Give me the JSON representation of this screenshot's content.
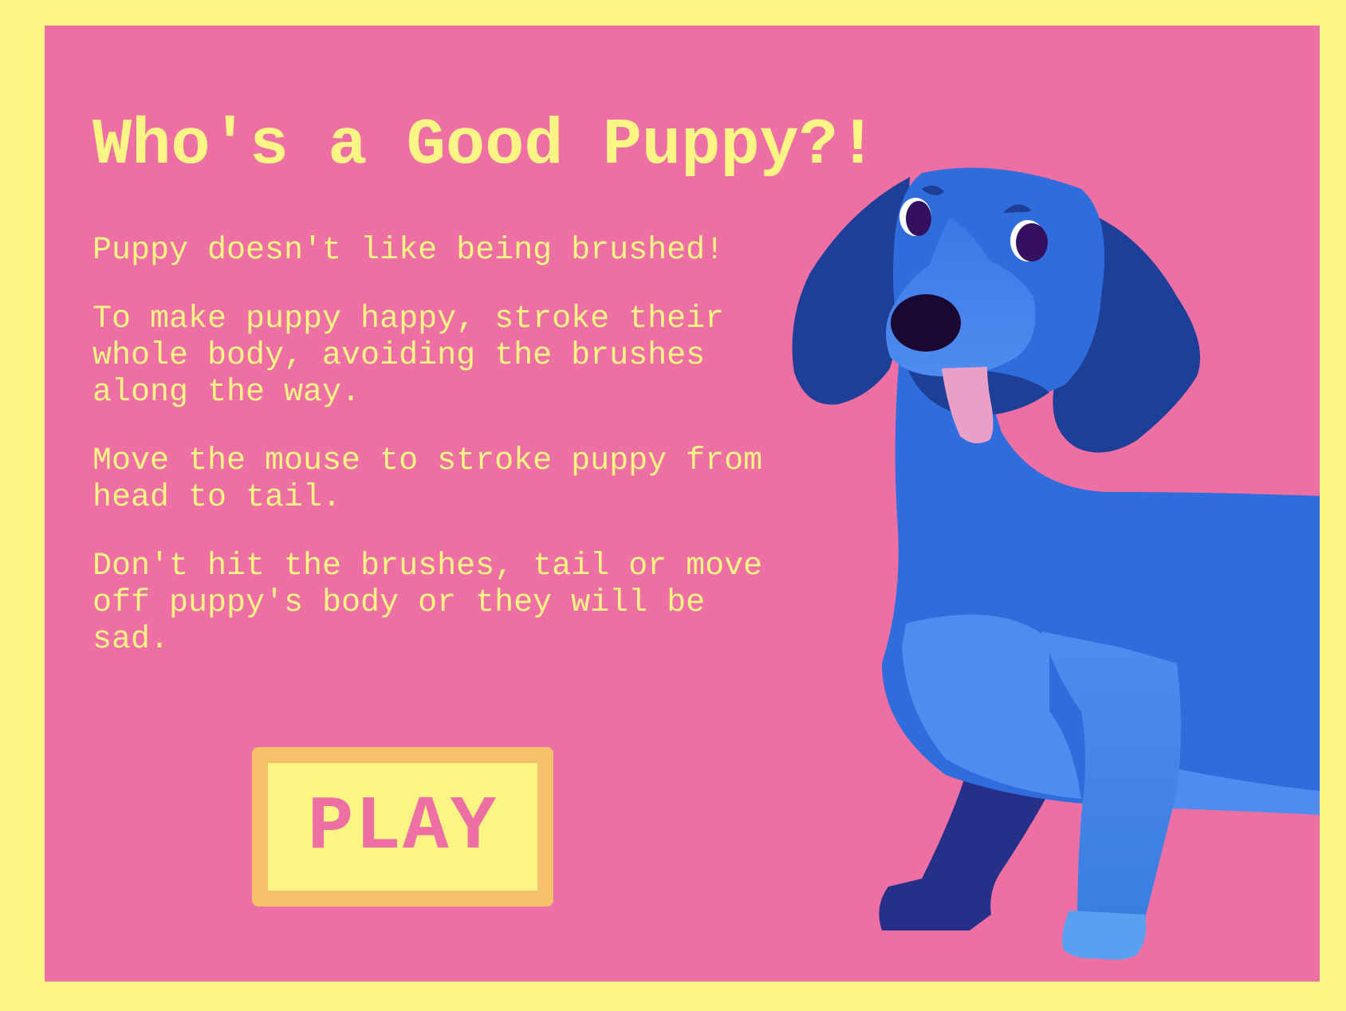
{
  "game": {
    "title": "Who's a Good Puppy?!",
    "instructions": [
      "Puppy doesn't like being brushed!",
      "To make puppy happy, stroke their\nwhole body, avoiding the brushes\nalong the way.",
      "Move the mouse to stroke puppy from\nhead to tail.",
      "Don't hit the brushes, tail or move\noff puppy's body or they will be\nsad."
    ],
    "play_label": "PLAY"
  },
  "colors": {
    "outer_background": "#faf585",
    "panel_background": "#ee6fa4",
    "text": "#faf585",
    "button_fill": "#faf585",
    "button_border": "#f5c26b",
    "puppy_body": "#2f6cdc",
    "puppy_ears": "#1d3f98",
    "puppy_light": "#4f8cf0",
    "puppy_nose": "#1a0833",
    "puppy_tongue": "#e8a0c6"
  },
  "icons": {
    "puppy": "dog-illustration"
  }
}
